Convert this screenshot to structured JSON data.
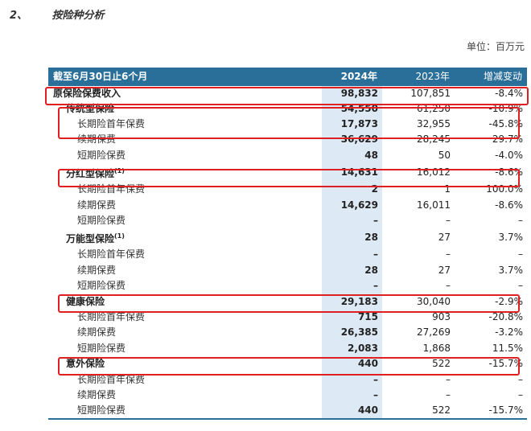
{
  "section": {
    "number": "2、",
    "title": "按险种分析"
  },
  "unit_label": "单位：百万元",
  "table": {
    "headers": [
      "截至6月30日止6个月",
      "2024年",
      "2023年",
      "增减变动"
    ],
    "rows": [
      {
        "label": "原保险保费收入",
        "note": "",
        "level": 0,
        "v2024": "98,832",
        "v2023": "107,851",
        "change": "-8.4%"
      },
      {
        "label": "传统型保险",
        "note": "",
        "level": 1,
        "v2024": "54,550",
        "v2023": "61,250",
        "change": "-10.9%"
      },
      {
        "label": "长期险首年保费",
        "note": "",
        "level": 2,
        "v2024": "17,873",
        "v2023": "32,955",
        "change": "-45.8%"
      },
      {
        "label": "续期保费",
        "note": "",
        "level": 2,
        "v2024": "36,629",
        "v2023": "28,245",
        "change": "29.7%"
      },
      {
        "label": "短期险保费",
        "note": "",
        "level": 2,
        "v2024": "48",
        "v2023": "50",
        "change": "-4.0%"
      },
      {
        "label": "分红型保险",
        "note": "(1)",
        "level": 1,
        "v2024": "14,631",
        "v2023": "16,012",
        "change": "-8.6%"
      },
      {
        "label": "长期险首年保费",
        "note": "",
        "level": 2,
        "v2024": "2",
        "v2023": "1",
        "change": "100.0%"
      },
      {
        "label": "续期保费",
        "note": "",
        "level": 2,
        "v2024": "14,629",
        "v2023": "16,011",
        "change": "-8.6%"
      },
      {
        "label": "短期险保费",
        "note": "",
        "level": 2,
        "v2024": "–",
        "v2023": "–",
        "change": "–"
      },
      {
        "label": "万能型保险",
        "note": "(1)",
        "level": 1,
        "v2024": "28",
        "v2023": "27",
        "change": "3.7%"
      },
      {
        "label": "长期险首年保费",
        "note": "",
        "level": 2,
        "v2024": "–",
        "v2023": "–",
        "change": "–"
      },
      {
        "label": "续期保费",
        "note": "",
        "level": 2,
        "v2024": "28",
        "v2023": "27",
        "change": "3.7%"
      },
      {
        "label": "短期险保费",
        "note": "",
        "level": 2,
        "v2024": "–",
        "v2023": "–",
        "change": "–"
      },
      {
        "label": "健康保险",
        "note": "",
        "level": 1,
        "v2024": "29,183",
        "v2023": "30,040",
        "change": "-2.9%"
      },
      {
        "label": "长期险首年保费",
        "note": "",
        "level": 2,
        "v2024": "715",
        "v2023": "903",
        "change": "-20.8%"
      },
      {
        "label": "续期保费",
        "note": "",
        "level": 2,
        "v2024": "26,385",
        "v2023": "27,269",
        "change": "-3.2%"
      },
      {
        "label": "短期险保费",
        "note": "",
        "level": 2,
        "v2024": "2,083",
        "v2023": "1,868",
        "change": "11.5%"
      },
      {
        "label": "意外保险",
        "note": "",
        "level": 1,
        "v2024": "440",
        "v2023": "522",
        "change": "-15.7%"
      },
      {
        "label": "长期险首年保费",
        "note": "",
        "level": 2,
        "v2024": "–",
        "v2023": "–",
        "change": "–"
      },
      {
        "label": "续期保费",
        "note": "",
        "level": 2,
        "v2024": "–",
        "v2023": "–",
        "change": "–"
      },
      {
        "label": "短期险保费",
        "note": "",
        "level": 2,
        "v2024": "440",
        "v2023": "522",
        "change": "-15.7%"
      }
    ]
  },
  "highlight_color": "#e02020",
  "header_color": "#2a6f9a",
  "current_year_shade": "#dde9f4"
}
